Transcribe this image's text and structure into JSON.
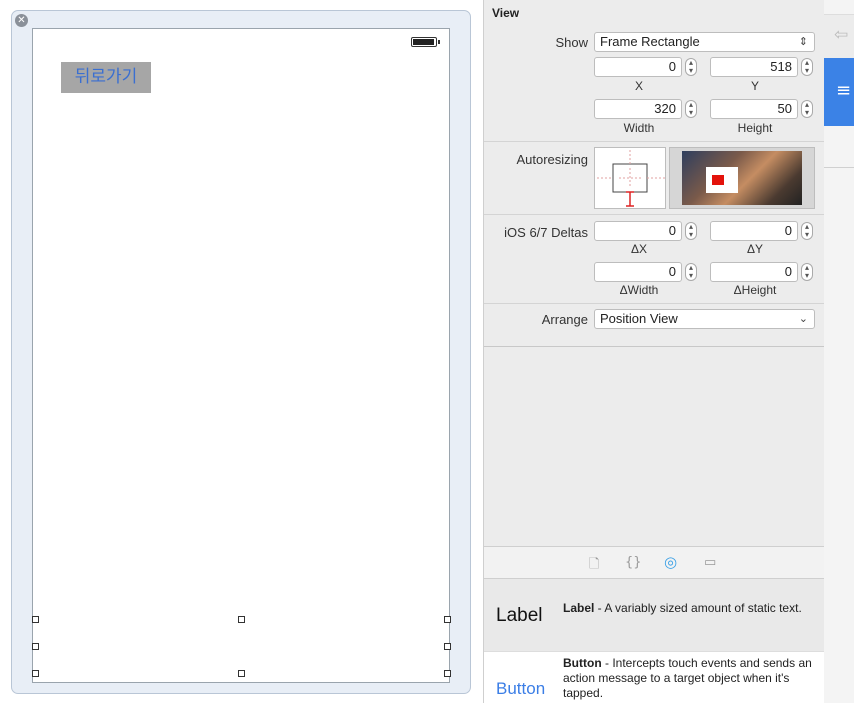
{
  "canvas": {
    "back_button_label": "뒤로가기"
  },
  "inspector": {
    "section_title": "View",
    "show": {
      "label": "Show",
      "value": "Frame Rectangle"
    },
    "frame": {
      "x": {
        "label": "X",
        "value": "0"
      },
      "y": {
        "label": "Y",
        "value": "518"
      },
      "width": {
        "label": "Width",
        "value": "320"
      },
      "height": {
        "label": "Height",
        "value": "50"
      }
    },
    "autoresizing_label": "Autoresizing",
    "deltas": {
      "label": "iOS 6/7 Deltas",
      "dx": {
        "label": "ΔX",
        "value": "0"
      },
      "dy": {
        "label": "ΔY",
        "value": "0"
      },
      "dwidth": {
        "label": "ΔWidth",
        "value": "0"
      },
      "dheight": {
        "label": "ΔHeight",
        "value": "0"
      }
    },
    "arrange": {
      "label": "Arrange",
      "value": "Position View"
    }
  },
  "library": {
    "tabs": [
      {
        "icon": "file-icon",
        "glyph": "🗋"
      },
      {
        "icon": "braces-icon",
        "glyph": "{}"
      },
      {
        "icon": "object-icon",
        "glyph": "◎"
      },
      {
        "icon": "media-icon",
        "glyph": "▭"
      }
    ],
    "items": [
      {
        "big": "Label",
        "name": "Label",
        "desc": " - A variably sized amount of static text."
      },
      {
        "big": "Button",
        "name": "Button",
        "desc": " - Intercepts touch events and sends an action message to a target object when it's tapped."
      }
    ]
  },
  "colors": {
    "accent": "#3b82e6",
    "button_bg": "#a6a6a6",
    "button_text": "#3a6fd1",
    "preview_red": "#e3120b"
  }
}
